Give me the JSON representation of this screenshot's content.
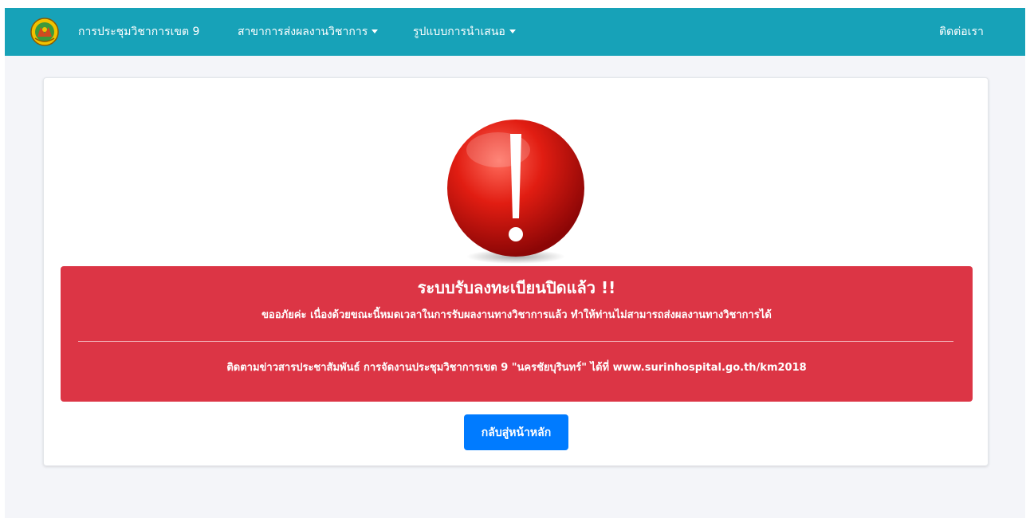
{
  "navbar": {
    "logo_icon": "hospital-seal-logo",
    "brand": "การประชุมวิชาการเขต 9",
    "menu": [
      {
        "label": "สาขาการส่งผลงานวิชาการ",
        "has_dropdown": true
      },
      {
        "label": "รูปแบบการนำเสนอ",
        "has_dropdown": true
      }
    ],
    "contact": "ติดต่อเรา"
  },
  "alert": {
    "icon": "exclamation-icon",
    "heading": "ระบบรับลงทะเบียนปิดแล้ว !!",
    "message": "ขออภัยค่ะ เนื่องด้วยขณะนี้หมดเวลาในการรับผลงานทางวิชาการแล้ว ทำให้ท่านไม่สามารถส่งผลงานทางวิชาการได้",
    "follow_up": "ติดตามข่าวสารประชาสัมพันธ์ การจัดงานประชุมวิชาการเขต 9 \"นครชัยบุรินทร์\" ได้ที่ www.surinhospital.go.th/km2018"
  },
  "home_button": "กลับสู่หน้าหลัก",
  "colors": {
    "navbar": "#17a2b8",
    "alert": "#dc3545",
    "primary_button": "#007bff",
    "page_background": "#f4f5f9"
  }
}
